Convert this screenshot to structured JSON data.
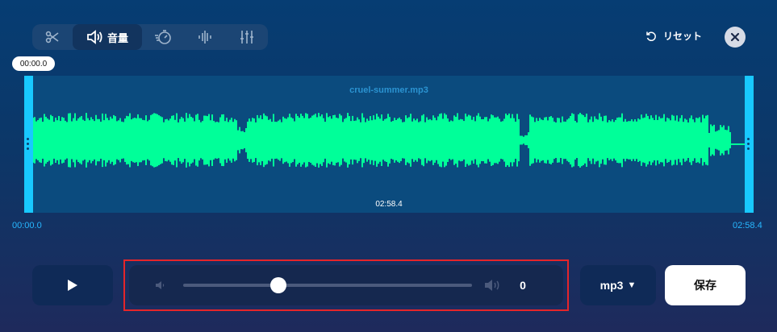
{
  "toolbar": {
    "tools": [
      {
        "icon": "scissors-icon",
        "label": ""
      },
      {
        "icon": "volume-icon",
        "label": "音量",
        "active": true
      },
      {
        "icon": "speed-icon",
        "label": ""
      },
      {
        "icon": "equalizer-icon",
        "label": ""
      },
      {
        "icon": "mixer-sliders-icon",
        "label": ""
      }
    ]
  },
  "header": {
    "reset_label": "リセット",
    "close_icon": "close-icon"
  },
  "timeline": {
    "cursor_time": "00:00.0",
    "filename": "cruel-summer.mp3",
    "duration_center": "02:58.4",
    "start_time": "00:00.0",
    "end_time": "02:58.4"
  },
  "colors": {
    "waveform": "#00ff99",
    "handle": "#18c9ff",
    "highlight_border": "#e5252a"
  },
  "controls": {
    "play_icon": "play-icon",
    "volume": {
      "value": "0",
      "slider_fraction": 0.33
    },
    "format": {
      "selected": "mp3"
    },
    "save_label": "保存"
  }
}
